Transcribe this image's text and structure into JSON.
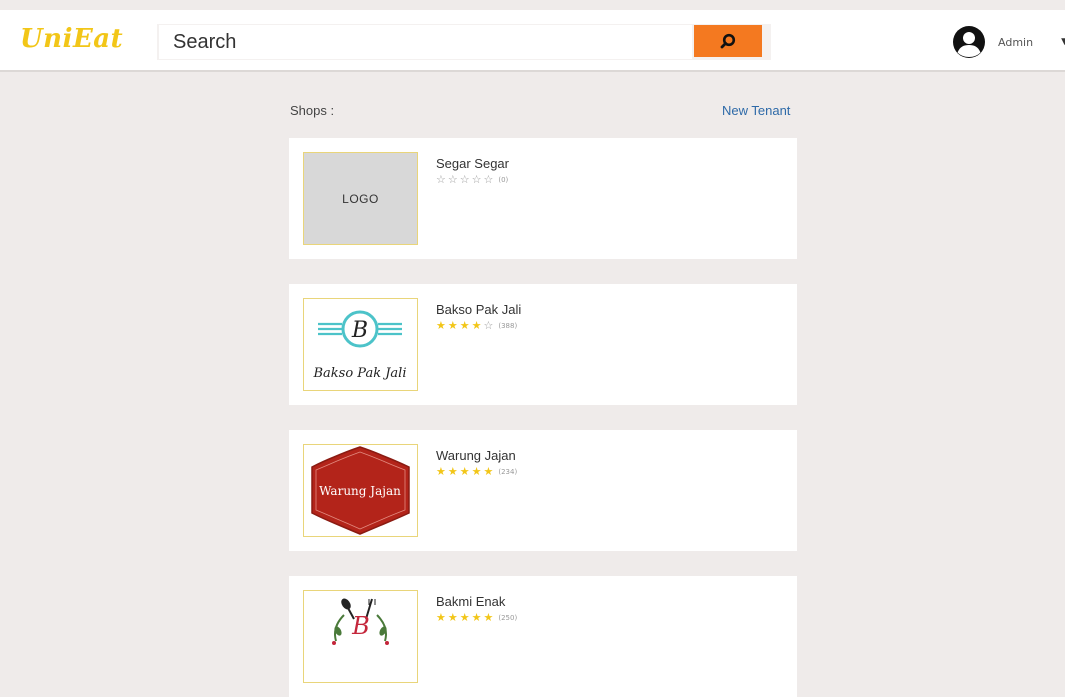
{
  "header": {
    "brand": "UniEat",
    "search": {
      "placeholder": "Search",
      "value": ""
    },
    "user": {
      "name": "Admin"
    }
  },
  "main": {
    "section_label": "Shops :",
    "new_tenant_label": "New Tenant",
    "shops": [
      {
        "name": "Segar Segar",
        "logo": "placeholder",
        "logo_text": "LOGO",
        "rating": 0,
        "rating_count": "(0)"
      },
      {
        "name": "Bakso Pak Jali",
        "logo": "bakso-pak-jali-logo",
        "logo_text": "Bakso Pak Jali",
        "logo_letter": "B",
        "rating": 4,
        "rating_count": "(388)"
      },
      {
        "name": "Warung Jajan",
        "logo": "warung-jajan-logo",
        "logo_text": "Warung Jajan",
        "rating": 5,
        "rating_count": "(234)"
      },
      {
        "name": "Bakmi Enak",
        "logo": "bakmi-enak-logo",
        "logo_letter": "B",
        "rating": 5,
        "rating_count": "(250)"
      }
    ]
  },
  "colors": {
    "accent": "#f47920",
    "brand": "#f2c618",
    "link": "#2e6aa8",
    "background": "#efebea",
    "star_filled": "#f2c618",
    "star_empty": "#9a9a9a"
  },
  "icons": {
    "search": "search-icon",
    "user": "user-avatar-icon",
    "dropdown": "caret-down-icon",
    "star_filled": "star-filled-icon",
    "star_empty": "star-outline-icon"
  }
}
